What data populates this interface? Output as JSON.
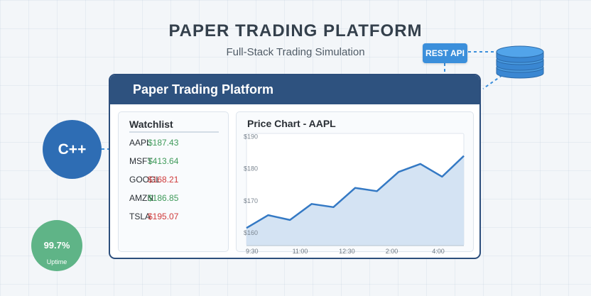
{
  "header": {
    "title": "PAPER TRADING PLATFORM",
    "subtitle": "Full-Stack Trading Simulation"
  },
  "api": {
    "label": "REST API"
  },
  "panel": {
    "title": "Paper Trading Platform"
  },
  "watchlist": {
    "title": "Watchlist",
    "items": [
      {
        "symbol": "AAPL",
        "price": "$187.43",
        "trend": "up"
      },
      {
        "symbol": "MSFT",
        "price": "$413.64",
        "trend": "up"
      },
      {
        "symbol": "GOOGL",
        "price": "$168.21",
        "trend": "down"
      },
      {
        "symbol": "AMZN",
        "price": "$186.85",
        "trend": "up"
      },
      {
        "symbol": "TSLA",
        "price": "$195.07",
        "trend": "down"
      }
    ]
  },
  "badges": {
    "language": "C++",
    "uptime_value": "99.7%",
    "uptime_label": "Uptime"
  },
  "colors": {
    "up": "#3f9a5a",
    "down": "#cf3a3a",
    "line": "#3479c4",
    "area": "#cfe0f2",
    "header": "#2e527f",
    "api": "#3b8fdb",
    "database": "#4a9be0"
  },
  "chart_data": {
    "type": "area",
    "title": "Price Chart - AAPL",
    "y_tick_labels": [
      "$190",
      "$180",
      "$170",
      "$160"
    ],
    "y_ticks": [
      190,
      180,
      170,
      160
    ],
    "x_tick_labels": [
      "9:30",
      "11:00",
      "12:30",
      "2:00",
      "4:00"
    ],
    "x_ticks": [
      0,
      3,
      6,
      9,
      12
    ],
    "ylim": [
      156,
      191
    ],
    "xlim": [
      0,
      14
    ],
    "values": [
      161.5,
      165.5,
      164,
      169,
      168,
      174,
      173,
      179,
      181.5,
      177.5,
      184
    ],
    "grid": false
  }
}
